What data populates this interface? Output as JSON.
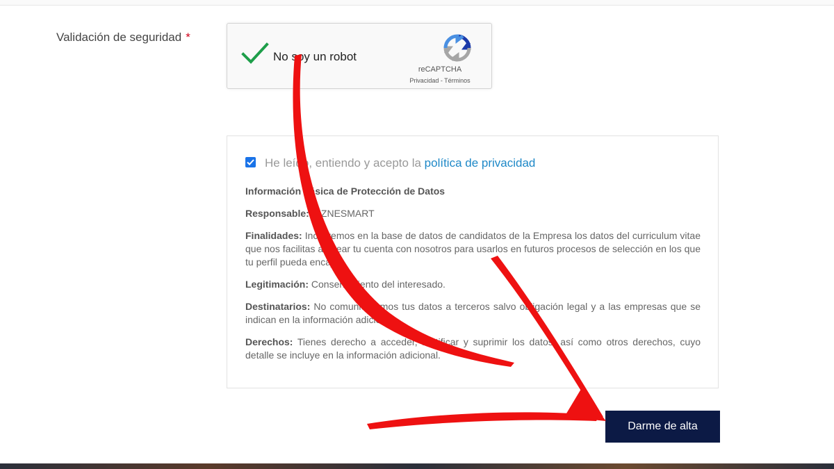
{
  "form": {
    "security_label": "Validación de seguridad",
    "required_mark": "*"
  },
  "captcha": {
    "label": "No soy un robot",
    "brand": "reCAPTCHA",
    "links": "Privacidad - Términos",
    "checked": true
  },
  "consent": {
    "checked": true,
    "text_prefix": "He leído, entiendo y acepto la ",
    "link_text": "política de privacidad"
  },
  "privacy_info": {
    "heading": "Información básica de Protección de Datos",
    "responsable_label": "Responsable:",
    "responsable_value": " BIZNESMART",
    "finalidades_label": "Finalidades:",
    "finalidades_value": " Incluiremos en la base de datos de candidatos de la Empresa los datos del curriculum vitae que nos facilitas al crear tu cuenta con nosotros para usarlos en futuros procesos de selección en los que tu perfil pueda encajar.",
    "legitimacion_label": "Legitimación:",
    "legitimacion_value": " Consentimiento del interesado.",
    "destinatarios_label": "Destinatarios:",
    "destinatarios_value": " No comunicaremos tus datos a terceros salvo obligación legal y a las empresas que se indican en la información adicional.",
    "derechos_label": "Derechos:",
    "derechos_value": " Tienes derecho a acceder, rectificar y suprimir los datos, así como otros derechos, cuyo detalle se incluye en la información adicional."
  },
  "submit": {
    "label": "Darme de alta"
  },
  "colors": {
    "button_bg": "#0c1a45",
    "link": "#1e88c7",
    "required": "#d0021b",
    "arrow": "#ee1111",
    "check": "#1e9e4a"
  },
  "icons": {
    "captcha_check": "green-check-icon",
    "recaptcha_logo": "recaptcha-logo-icon",
    "arrow_overlay": "red-arrow-icon"
  }
}
